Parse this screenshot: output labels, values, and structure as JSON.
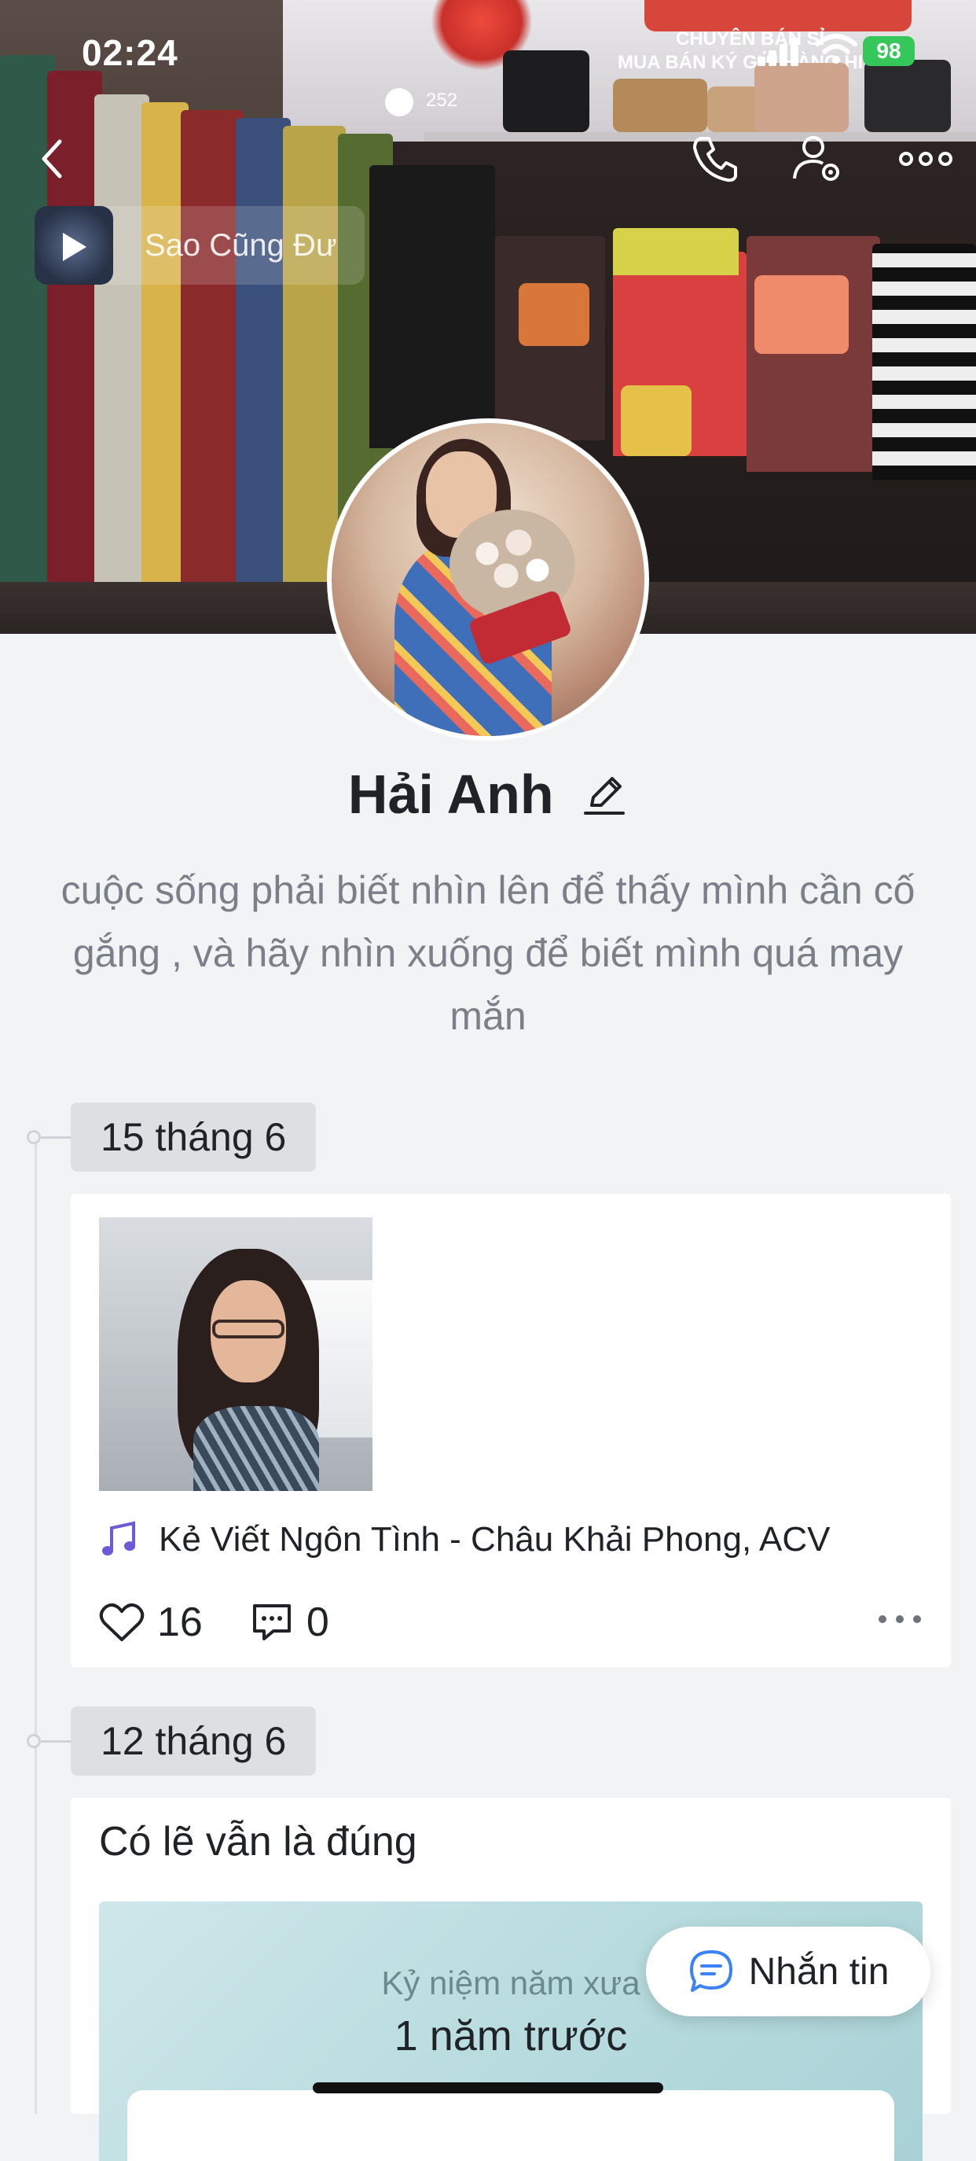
{
  "status_bar": {
    "time": "02:24",
    "battery": "98"
  },
  "cover": {
    "sign_line1": "CHUYÊN BÁN SỈ",
    "sign_line2": "MUA BÁN KÝ GỬI HÀNG HIỆU",
    "sign_small": "252"
  },
  "header": {
    "back_icon": "chevron-left-icon",
    "call_icon": "phone-icon",
    "settings_icon": "user-settings-icon",
    "more_icon": "more-horizontal-icon"
  },
  "music": {
    "title": "Sao Cũng Đư"
  },
  "profile": {
    "name": "Hải Anh",
    "bio": "cuộc sống phải biết nhìn lên để thấy mình cần cố gắng , và hãy nhìn xuống để biết mình quá may mắn"
  },
  "timeline": [
    {
      "date": "15 tháng 6",
      "song": "Kẻ Viết Ngôn Tình - Châu Khải Phong, ACV",
      "likes": "16",
      "comments": "0"
    },
    {
      "date": "12 tháng 6",
      "text": "Có lẽ vẫn là đúng",
      "memory_sub": "Kỷ niệm năm xưa",
      "memory_main": "1 năm trước"
    }
  ],
  "message_button": {
    "label": "Nhắn tin"
  },
  "colors": {
    "accent": "#3b82f6",
    "music_note": "#6b5bd6",
    "background": "#f2f3f5"
  }
}
